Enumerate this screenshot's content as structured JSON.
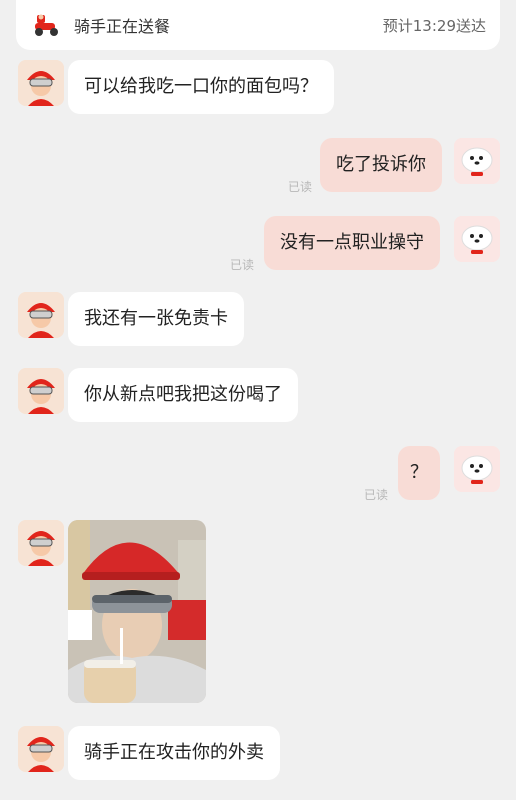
{
  "status": {
    "title": "骑手正在送餐",
    "eta": "预计13:29送达"
  },
  "messages": [
    {
      "side": "left",
      "text": "可以给我吃一口你的面包吗？"
    },
    {
      "side": "right",
      "text": "吃了投诉你",
      "read": "已读"
    },
    {
      "side": "right",
      "text": "没有一点职业操守",
      "read": "已读"
    },
    {
      "side": "left",
      "text": "我还有一张免责卡"
    },
    {
      "side": "left",
      "text": "你从新点吧我把这份喝了"
    },
    {
      "side": "right",
      "text": "？",
      "read": "已读"
    },
    {
      "side": "left",
      "type": "image",
      "content": "photo"
    },
    {
      "side": "left",
      "text": "骑手正在攻击你的外卖"
    }
  ],
  "colors": {
    "background": "#f0f0f0",
    "bubble_left": "#ffffff",
    "bubble_right": "#f8dcd6",
    "read_text": "#b8b8b8",
    "brand_red": "#e1251b"
  },
  "icons": {
    "rider": "rider-avatar-icon",
    "user": "jd-dog-avatar-icon",
    "status": "delivery-scooter-icon"
  }
}
